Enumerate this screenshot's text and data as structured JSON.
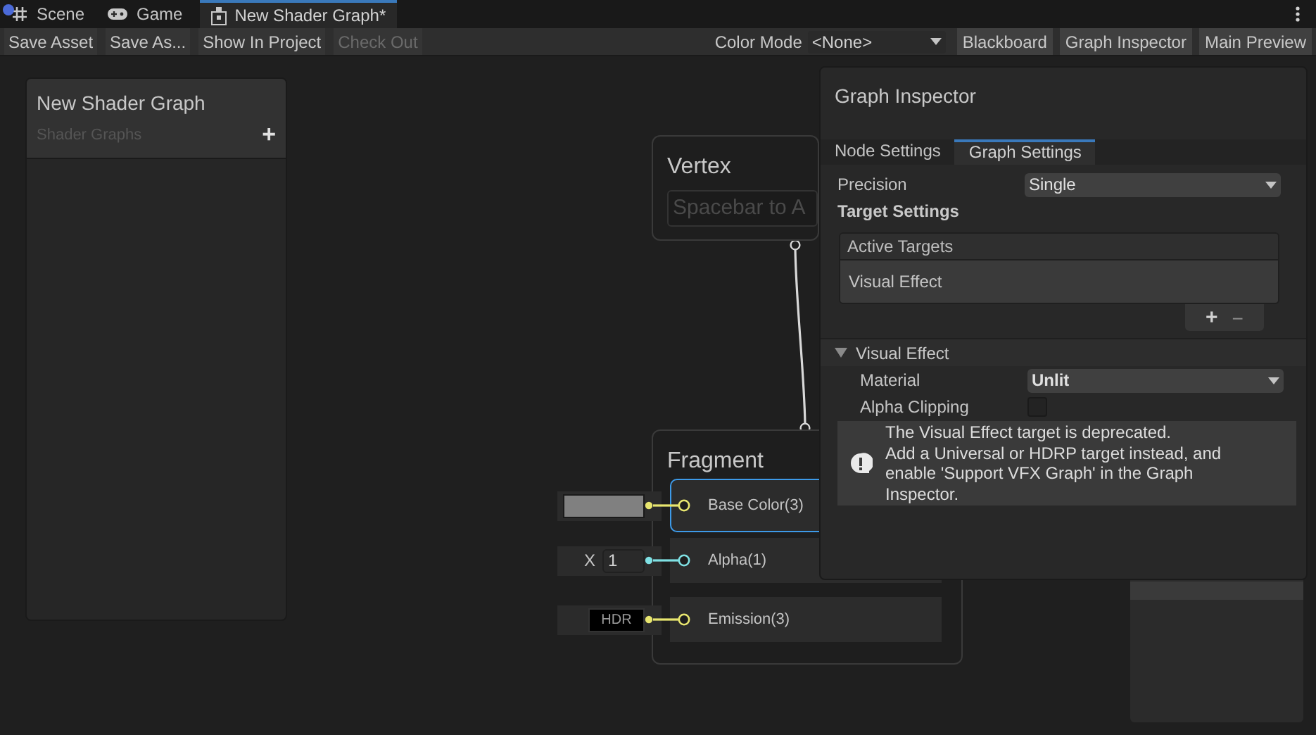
{
  "tabs": [
    {
      "label": "Scene",
      "kind": "scene",
      "selected": false
    },
    {
      "label": "Game",
      "kind": "game",
      "selected": false
    },
    {
      "label": "New Shader Graph*",
      "kind": "shader",
      "selected": true
    }
  ],
  "toolbar": {
    "left_buttons": [
      {
        "label": "Save Asset",
        "disabled": false
      },
      {
        "label": "Save As...",
        "disabled": false
      },
      {
        "label": "Show In Project",
        "disabled": false
      },
      {
        "label": "Check Out",
        "disabled": true
      }
    ],
    "color_mode": {
      "label": "Color Mode",
      "value": "<None>"
    },
    "right_buttons": [
      {
        "label": "Blackboard"
      },
      {
        "label": "Graph Inspector"
      },
      {
        "label": "Main Preview"
      }
    ]
  },
  "blackboard": {
    "title": "New Shader Graph",
    "subtitle": "Shader Graphs",
    "add": "+"
  },
  "vertex_node": {
    "title": "Vertex",
    "field_text": "Spacebar to A"
  },
  "fragment_node": {
    "title": "Fragment",
    "ports": [
      {
        "label": "Base Color(3)",
        "selected": true,
        "color": "#e8e66f",
        "input": {
          "kind": "swatch"
        }
      },
      {
        "label": "Alpha(1)",
        "selected": false,
        "color": "#7fe0e3",
        "input": {
          "kind": "float",
          "axis": "X",
          "value": "1"
        }
      },
      {
        "label": "Emission(3)",
        "selected": false,
        "color": "#e8e66f",
        "input": {
          "kind": "hdr",
          "text": "HDR"
        }
      }
    ]
  },
  "inspector": {
    "title": "Graph Inspector",
    "tabs": [
      {
        "label": "Node Settings",
        "selected": false
      },
      {
        "label": "Graph Settings",
        "selected": true
      }
    ],
    "precision": {
      "label": "Precision",
      "value": "Single"
    },
    "target_settings": "Target Settings",
    "active_targets": {
      "header": "Active Targets",
      "items": [
        "Visual Effect"
      ],
      "add": "+",
      "remove": "−"
    },
    "section": {
      "title": "Visual Effect",
      "expanded": true
    },
    "material": {
      "label": "Material",
      "value": "Unlit"
    },
    "alpha_clipping": {
      "label": "Alpha Clipping",
      "checked": false
    },
    "warning": [
      "The Visual Effect target is deprecated.",
      "Add a Universal or HDRP target instead, and enable 'Support VFX Graph' in the Graph Inspector."
    ]
  }
}
